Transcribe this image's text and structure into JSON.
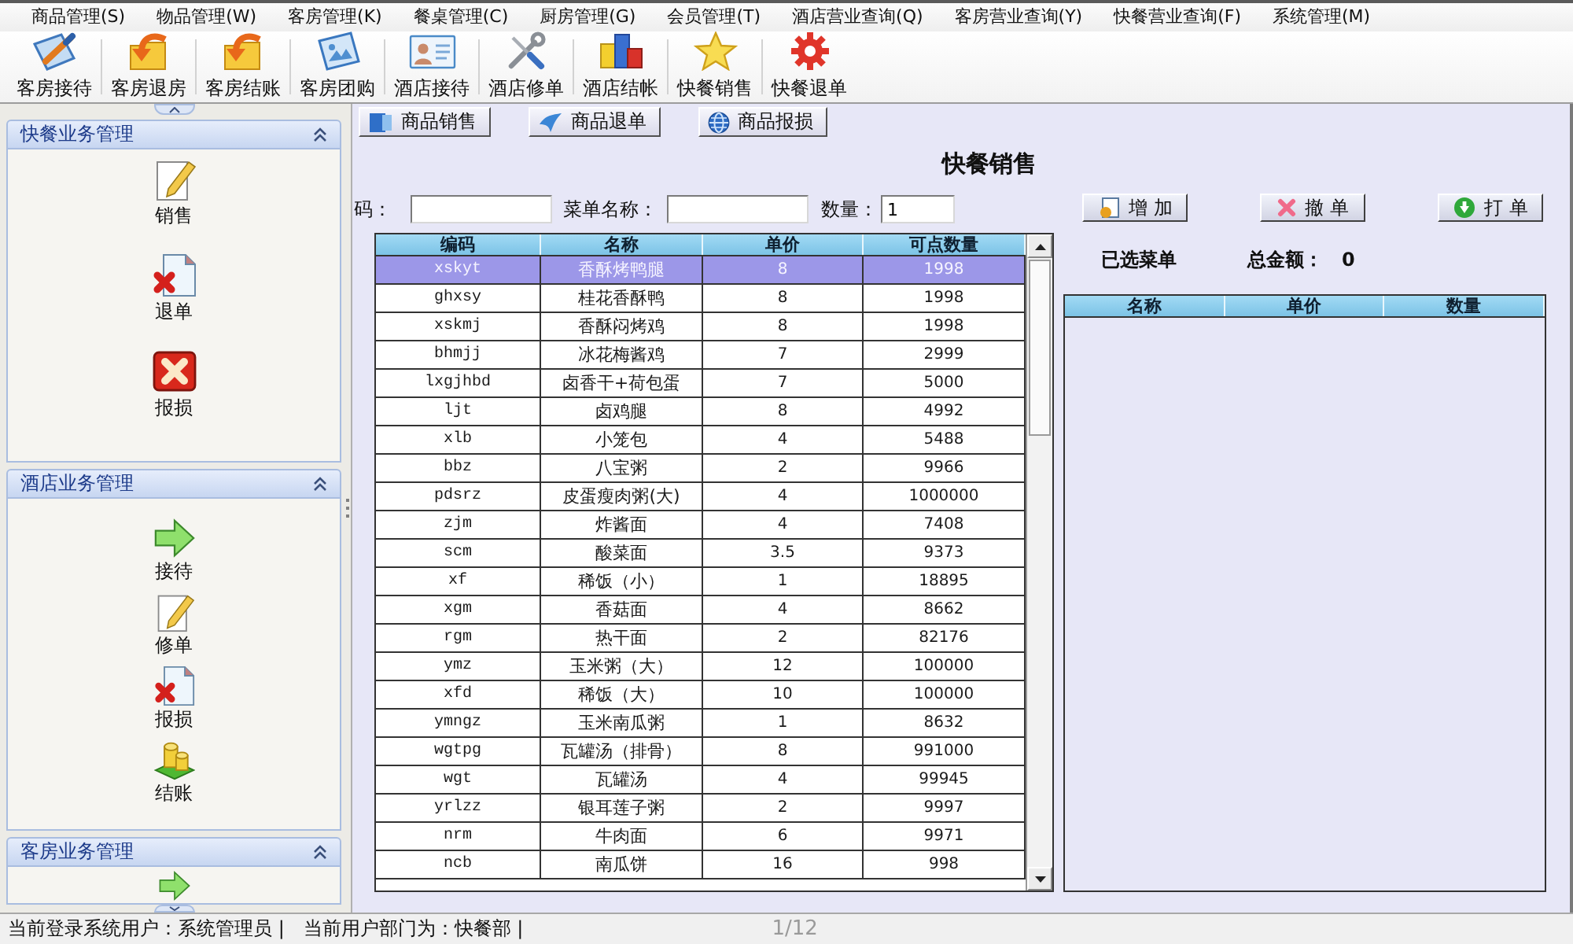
{
  "menu_bar": [
    "商品管理(S)",
    "物品管理(W)",
    "客房管理(K)",
    "餐桌管理(C)",
    "厨房管理(G)",
    "会员管理(T)",
    "酒店营业查询(Q)",
    "客房营业查询(Y)",
    "快餐营业查询(F)",
    "系统管理(M)"
  ],
  "toolbar": [
    {
      "label": "客房接待",
      "kind": "pen"
    },
    {
      "label": "客房退房",
      "kind": "folder"
    },
    {
      "label": "客房结账",
      "kind": "folder"
    },
    {
      "label": "客房团购",
      "kind": "picture"
    },
    {
      "label": "酒店接待",
      "kind": "idcard"
    },
    {
      "label": "酒店修单",
      "kind": "tools"
    },
    {
      "label": "酒店结帐",
      "kind": "blocks"
    },
    {
      "label": "快餐销售",
      "kind": "star"
    },
    {
      "label": "快餐退单",
      "kind": "gear"
    }
  ],
  "sidebar": {
    "sections": [
      {
        "title": "快餐业务管理",
        "expanded": true,
        "items": [
          {
            "label": "销售",
            "kind": "edit"
          },
          {
            "label": "退单",
            "kind": "delete"
          },
          {
            "label": "报损",
            "kind": "cancel"
          }
        ]
      },
      {
        "title": "酒店业务管理",
        "expanded": true,
        "items": [
          {
            "label": "接待",
            "kind": "forward"
          },
          {
            "label": "修单",
            "kind": "edit"
          },
          {
            "label": "报损",
            "kind": "delete"
          },
          {
            "label": "结账",
            "kind": "coins"
          }
        ]
      },
      {
        "title": "客房业务管理",
        "expanded": true,
        "items": [
          {
            "kind": "forward"
          }
        ]
      }
    ]
  },
  "function_buttons": [
    {
      "label": "商品销售",
      "kind": "sale"
    },
    {
      "label": "商品退单",
      "kind": "return"
    },
    {
      "label": "商品报损",
      "kind": "loss"
    }
  ],
  "title": "快餐销售",
  "search": [
    {
      "label": "码：",
      "kind": "code"
    },
    {
      "label": "菜单名称：",
      "kind": "name"
    },
    {
      "label": "数量：",
      "kind": "quantity",
      "value": "1"
    }
  ],
  "menu_table": {
    "columns": [
      "编码",
      "名称",
      "单价",
      "可点数量"
    ],
    "rows": [
      {
        "cells": [
          "xskyt",
          "香酥烤鸭腿",
          "8",
          "1998"
        ],
        "selected": true
      },
      {
        "cells": [
          "ghxsy",
          "桂花香酥鸭",
          "8",
          "1998"
        ],
        "selected": false
      },
      {
        "cells": [
          "xskmj",
          "香酥闷烤鸡",
          "8",
          "1998"
        ],
        "selected": false
      },
      {
        "cells": [
          "bhmjj",
          "冰花梅酱鸡",
          "7",
          "2999"
        ],
        "selected": false
      },
      {
        "cells": [
          "lxgjhbd",
          "卤香干+荷包蛋",
          "7",
          "5000"
        ],
        "selected": false
      },
      {
        "cells": [
          "ljt",
          "卤鸡腿",
          "8",
          "4992"
        ],
        "selected": false
      },
      {
        "cells": [
          "xlb",
          "小笼包",
          "4",
          "5488"
        ],
        "selected": false
      },
      {
        "cells": [
          "bbz",
          "八宝粥",
          "2",
          "9966"
        ],
        "selected": false
      },
      {
        "cells": [
          "pdsrz",
          "皮蛋瘦肉粥(大)",
          "4",
          "1000000"
        ],
        "selected": false
      },
      {
        "cells": [
          "zjm",
          "炸酱面",
          "4",
          "7408"
        ],
        "selected": false
      },
      {
        "cells": [
          "scm",
          "酸菜面",
          "3.5",
          "9373"
        ],
        "selected": false
      },
      {
        "cells": [
          "xf",
          "稀饭（小）",
          "1",
          "18895"
        ],
        "selected": false
      },
      {
        "cells": [
          "xgm",
          "香菇面",
          "4",
          "8662"
        ],
        "selected": false
      },
      {
        "cells": [
          "rgm",
          "热干面",
          "2",
          "82176"
        ],
        "selected": false
      },
      {
        "cells": [
          "ymz",
          "玉米粥（大）",
          "12",
          "100000"
        ],
        "selected": false
      },
      {
        "cells": [
          "xfd",
          "稀饭（大）",
          "10",
          "100000"
        ],
        "selected": false
      },
      {
        "cells": [
          "ymngz",
          "玉米南瓜粥",
          "1",
          "8632"
        ],
        "selected": false
      },
      {
        "cells": [
          "wgtpg",
          "瓦罐汤（排骨）",
          "8",
          "991000"
        ],
        "selected": false
      },
      {
        "cells": [
          "wgt",
          "瓦罐汤",
          "4",
          "99945"
        ],
        "selected": false
      },
      {
        "cells": [
          "yrlzz",
          "银耳莲子粥",
          "2",
          "9997"
        ],
        "selected": false
      },
      {
        "cells": [
          "nrm",
          "牛肉面",
          "6",
          "9971"
        ],
        "selected": false
      },
      {
        "cells": [
          "ncb",
          "南瓜饼",
          "16",
          "998"
        ],
        "selected": false
      }
    ]
  },
  "actions": [
    {
      "label": "增 加",
      "kind": "add"
    },
    {
      "label": "撤 单",
      "kind": "cancel"
    },
    {
      "label": "打 单",
      "kind": "print"
    }
  ],
  "summary": {
    "label": "已选菜单",
    "total_label": "总金额：",
    "total": "0"
  },
  "selected_table": {
    "columns": [
      "名称",
      "单价",
      "数量"
    ]
  },
  "status_bar": {
    "items": [
      "当前登录系统用户：系统管理员 |",
      "当前用户部门为：快餐部 |"
    ],
    "page": "1/12"
  }
}
